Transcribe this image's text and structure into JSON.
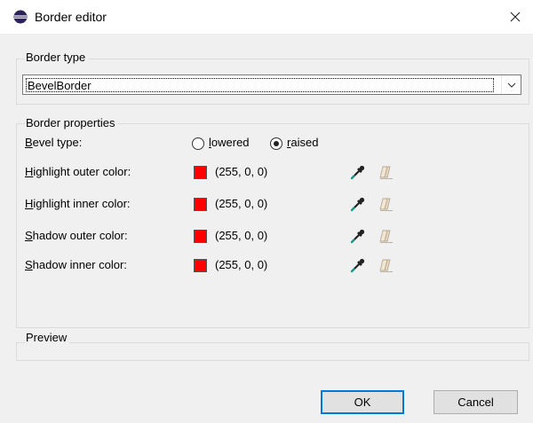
{
  "window": {
    "title": "Border editor",
    "close_glyph": "✕"
  },
  "border_type": {
    "group_label": "Border type",
    "selected_value": "BevelBorder"
  },
  "border_properties": {
    "group_label": "Border properties",
    "bevel_type": {
      "label_accel": "B",
      "label_rest": "evel type:",
      "options": [
        {
          "accel": "l",
          "rest": "owered",
          "checked": false
        },
        {
          "accel": "r",
          "rest": "aised",
          "checked": true
        }
      ]
    },
    "colors": [
      {
        "label_accel": "H",
        "label_rest": "ighlight outer color:",
        "value": "(255, 0, 0)",
        "swatch": "#ff0000"
      },
      {
        "label_accel": "H",
        "label_rest": "ighlight inner color:",
        "value": "(255, 0, 0)",
        "swatch": "#ff0000"
      },
      {
        "label_accel": "S",
        "label_rest": "hadow outer color:",
        "value": "(255, 0, 0)",
        "swatch": "#ff0000"
      },
      {
        "label_accel": "S",
        "label_rest": "hadow inner color:",
        "value": "(255, 0, 0)",
        "swatch": "#ff0000"
      }
    ]
  },
  "preview": {
    "group_label": "Preview"
  },
  "buttons": {
    "ok": "OK",
    "cancel": "Cancel"
  },
  "icons": {
    "app": "eclipse-icon",
    "picker": "eyedropper-icon",
    "clear": "eraser-icon",
    "combo": "chevron-down-icon"
  }
}
